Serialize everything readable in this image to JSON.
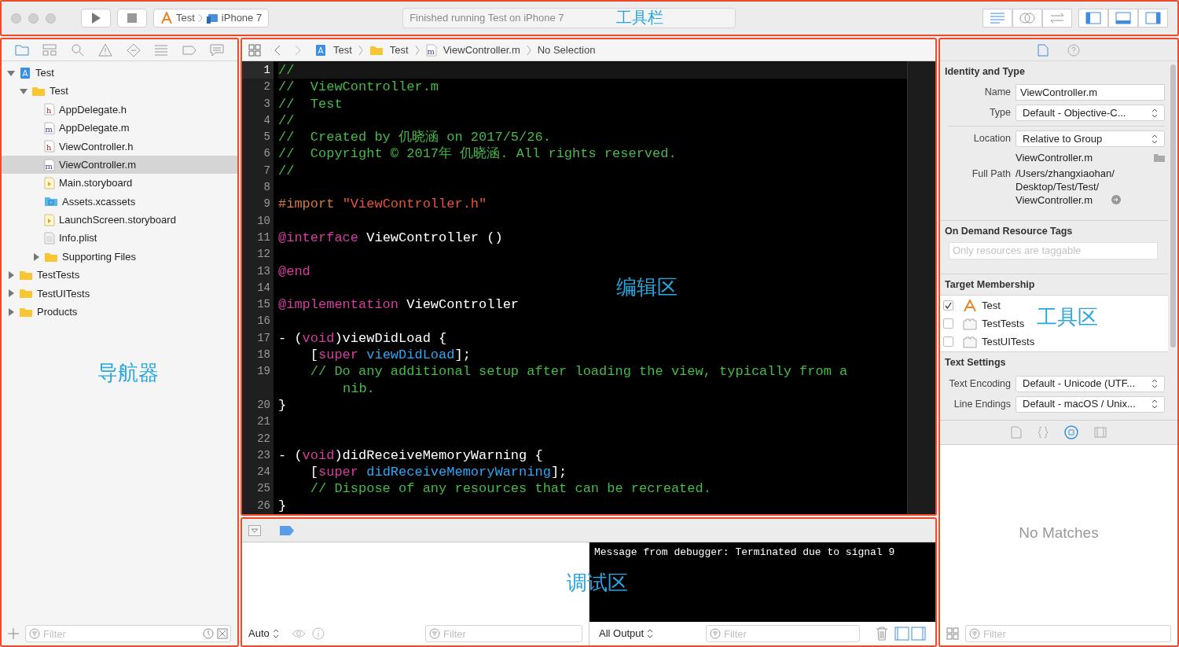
{
  "toolbar": {
    "scheme": "Test",
    "device": "iPhone 7",
    "status": "Finished running Test on iPhone 7",
    "annotation": "工具栏",
    "view_buttons": [
      {
        "kind": "editor-standard",
        "selected": true
      },
      {
        "kind": "editor-assistant",
        "selected": false
      },
      {
        "kind": "editor-version",
        "selected": false
      },
      {
        "kind": "navigator-panel",
        "selected": true
      },
      {
        "kind": "debug-panel",
        "selected": true
      },
      {
        "kind": "utilities-panel",
        "selected": true
      }
    ]
  },
  "navigator": {
    "tabs": [
      {
        "kind": "project",
        "selected": true
      },
      {
        "kind": "symbol",
        "selected": false
      },
      {
        "kind": "search",
        "selected": false
      },
      {
        "kind": "issue",
        "selected": false
      },
      {
        "kind": "test",
        "selected": false
      },
      {
        "kind": "debug",
        "selected": false
      },
      {
        "kind": "breakpoint",
        "selected": false
      },
      {
        "kind": "report",
        "selected": false
      }
    ],
    "tree": [
      {
        "name": "Test",
        "kind": "project",
        "expanded": true,
        "selected": false,
        "children": [
          {
            "name": "Test",
            "kind": "folder",
            "expanded": true,
            "selected": false,
            "children": [
              {
                "name": "AppDelegate.h",
                "kind": "h",
                "selected": false
              },
              {
                "name": "AppDelegate.m",
                "kind": "m",
                "selected": false
              },
              {
                "name": "ViewController.h",
                "kind": "h",
                "selected": false
              },
              {
                "name": "ViewController.m",
                "kind": "m",
                "selected": true
              },
              {
                "name": "Main.storyboard",
                "kind": "storyboard",
                "selected": false
              },
              {
                "name": "Assets.xcassets",
                "kind": "assets",
                "selected": false
              },
              {
                "name": "LaunchScreen.storyboard",
                "kind": "storyboard",
                "selected": false
              },
              {
                "name": "Info.plist",
                "kind": "plist",
                "selected": false
              },
              {
                "name": "Supporting Files",
                "kind": "folder",
                "expanded": false,
                "selected": false
              }
            ]
          }
        ]
      },
      {
        "name": "TestTests",
        "kind": "folder",
        "expanded": false,
        "selected": false
      },
      {
        "name": "TestUITests",
        "kind": "folder",
        "expanded": false,
        "selected": false
      },
      {
        "name": "Products",
        "kind": "folder",
        "expanded": false,
        "selected": false
      }
    ],
    "filter": {
      "placeholder": "Filter"
    },
    "annotation": "导航器"
  },
  "editor": {
    "breadcrumbs": [
      {
        "text": "Test",
        "kind": "project"
      },
      {
        "text": "Test",
        "kind": "folder"
      },
      {
        "text": "ViewController.m",
        "kind": "m"
      },
      {
        "text": "No Selection",
        "kind": "none"
      }
    ],
    "lines": [
      {
        "number": "1",
        "current": true,
        "tokens": [
          {
            "kind": "comment",
            "text": "//"
          }
        ]
      },
      {
        "number": "2",
        "current": false,
        "tokens": [
          {
            "kind": "comment",
            "text": "//  ViewController.m"
          }
        ]
      },
      {
        "number": "3",
        "current": false,
        "tokens": [
          {
            "kind": "comment",
            "text": "//  Test"
          }
        ]
      },
      {
        "number": "4",
        "current": false,
        "tokens": [
          {
            "kind": "comment",
            "text": "//"
          }
        ]
      },
      {
        "number": "5",
        "current": false,
        "tokens": [
          {
            "kind": "comment",
            "text": "//  Created by 仉晓涵 on 2017/5/26."
          }
        ]
      },
      {
        "number": "6",
        "current": false,
        "tokens": [
          {
            "kind": "comment",
            "text": "//  Copyright © 2017年 仉晓涵. All rights reserved."
          }
        ]
      },
      {
        "number": "7",
        "current": false,
        "tokens": [
          {
            "kind": "comment",
            "text": "//"
          }
        ]
      },
      {
        "number": "8",
        "current": false
      },
      {
        "number": "9",
        "current": false,
        "tokens": [
          {
            "kind": "preprocessor",
            "text": "#import "
          },
          {
            "kind": "string",
            "text": "\"ViewController.h\""
          }
        ]
      },
      {
        "number": "10",
        "current": false
      },
      {
        "number": "11",
        "current": false,
        "tokens": [
          {
            "kind": "keyword",
            "text": "@interface"
          },
          {
            "kind": "plain",
            "text": " ViewController ()"
          }
        ]
      },
      {
        "number": "12",
        "current": false
      },
      {
        "number": "13",
        "current": false,
        "tokens": [
          {
            "kind": "keyword",
            "text": "@end"
          }
        ]
      },
      {
        "number": "14",
        "current": false
      },
      {
        "number": "15",
        "current": false,
        "tokens": [
          {
            "kind": "keyword",
            "text": "@implementation"
          },
          {
            "kind": "plain",
            "text": " ViewController"
          }
        ]
      },
      {
        "number": "16",
        "current": false
      },
      {
        "number": "17",
        "current": false,
        "tokens": [
          {
            "kind": "plain",
            "text": "- ("
          },
          {
            "kind": "keyword",
            "text": "void"
          },
          {
            "kind": "plain",
            "text": ")viewDidLoad {"
          }
        ]
      },
      {
        "number": "18",
        "current": false,
        "tokens": [
          {
            "kind": "plain",
            "text": "    ["
          },
          {
            "kind": "keyword",
            "text": "super"
          },
          {
            "kind": "method",
            "text": " viewDidLoad"
          },
          {
            "kind": "plain",
            "text": "];"
          }
        ]
      },
      {
        "number": "19",
        "current": false,
        "tokens": [
          {
            "kind": "comment",
            "text": "    // Do any additional setup after loading the view, typically from a"
          }
        ],
        "wrap": "nib."
      },
      {
        "number": "20",
        "current": false,
        "tokens": [
          {
            "kind": "plain",
            "text": "}"
          }
        ]
      },
      {
        "number": "21",
        "current": false
      },
      {
        "number": "22",
        "current": false
      },
      {
        "number": "23",
        "current": false,
        "tokens": [
          {
            "kind": "plain",
            "text": "- ("
          },
          {
            "kind": "keyword",
            "text": "void"
          },
          {
            "kind": "plain",
            "text": ")didReceiveMemoryWarning {"
          }
        ]
      },
      {
        "number": "24",
        "current": false,
        "tokens": [
          {
            "kind": "plain",
            "text": "    ["
          },
          {
            "kind": "keyword",
            "text": "super"
          },
          {
            "kind": "method",
            "text": " didReceiveMemoryWarning"
          },
          {
            "kind": "plain",
            "text": "];"
          }
        ]
      },
      {
        "number": "25",
        "current": false,
        "tokens": [
          {
            "kind": "comment",
            "text": "    // Dispose of any resources that can be recreated."
          }
        ]
      },
      {
        "number": "26",
        "current": false,
        "tokens": [
          {
            "kind": "plain",
            "text": "}"
          }
        ]
      }
    ],
    "annotation": "编辑区"
  },
  "debug": {
    "scope": "Auto",
    "console_text": "Message from debugger: Terminated due to signal 9",
    "output": "All Output",
    "variables_filter": {
      "placeholder": "Filter"
    },
    "console_filter": {
      "placeholder": "Filter"
    },
    "annotation": "调试区"
  },
  "inspector": {
    "tabs": [
      {
        "kind": "file",
        "selected": true
      },
      {
        "kind": "help",
        "selected": false
      }
    ],
    "identity": {
      "title": "Identity and Type",
      "name_label": "Name",
      "name_value": "ViewController.m",
      "type_label": "Type",
      "type_value": "Default - Objective-C...",
      "location_label": "Location",
      "location_value": "Relative to Group",
      "location_file": "ViewController.m",
      "full_path_label": "Full Path",
      "full_path_lines": [
        "/Users/zhangxiaohan/",
        "Desktop/Test/Test/",
        "ViewController.m"
      ]
    },
    "tags": {
      "title": "On Demand Resource Tags",
      "placeholder": "Only resources are taggable"
    },
    "membership": {
      "title": "Target Membership",
      "targets": [
        {
          "name": "Test",
          "kind": "app",
          "checked": true
        },
        {
          "name": "TestTests",
          "kind": "bundle",
          "checked": false
        },
        {
          "name": "TestUITests",
          "kind": "bundle",
          "checked": false
        }
      ]
    },
    "text_settings": {
      "title": "Text Settings",
      "encoding_label": "Text Encoding",
      "encoding_value": "Default - Unicode (UTF...",
      "endings_label": "Line Endings",
      "endings_value": "Default - macOS / Unix..."
    },
    "library_tabs": [
      {
        "kind": "file-template",
        "selected": false
      },
      {
        "kind": "code-snippet",
        "selected": false
      },
      {
        "kind": "object",
        "selected": true
      },
      {
        "kind": "media",
        "selected": false
      }
    ],
    "empty_text": "No Matches",
    "filter": {
      "placeholder": "Filter"
    },
    "annotation": "工具区"
  }
}
